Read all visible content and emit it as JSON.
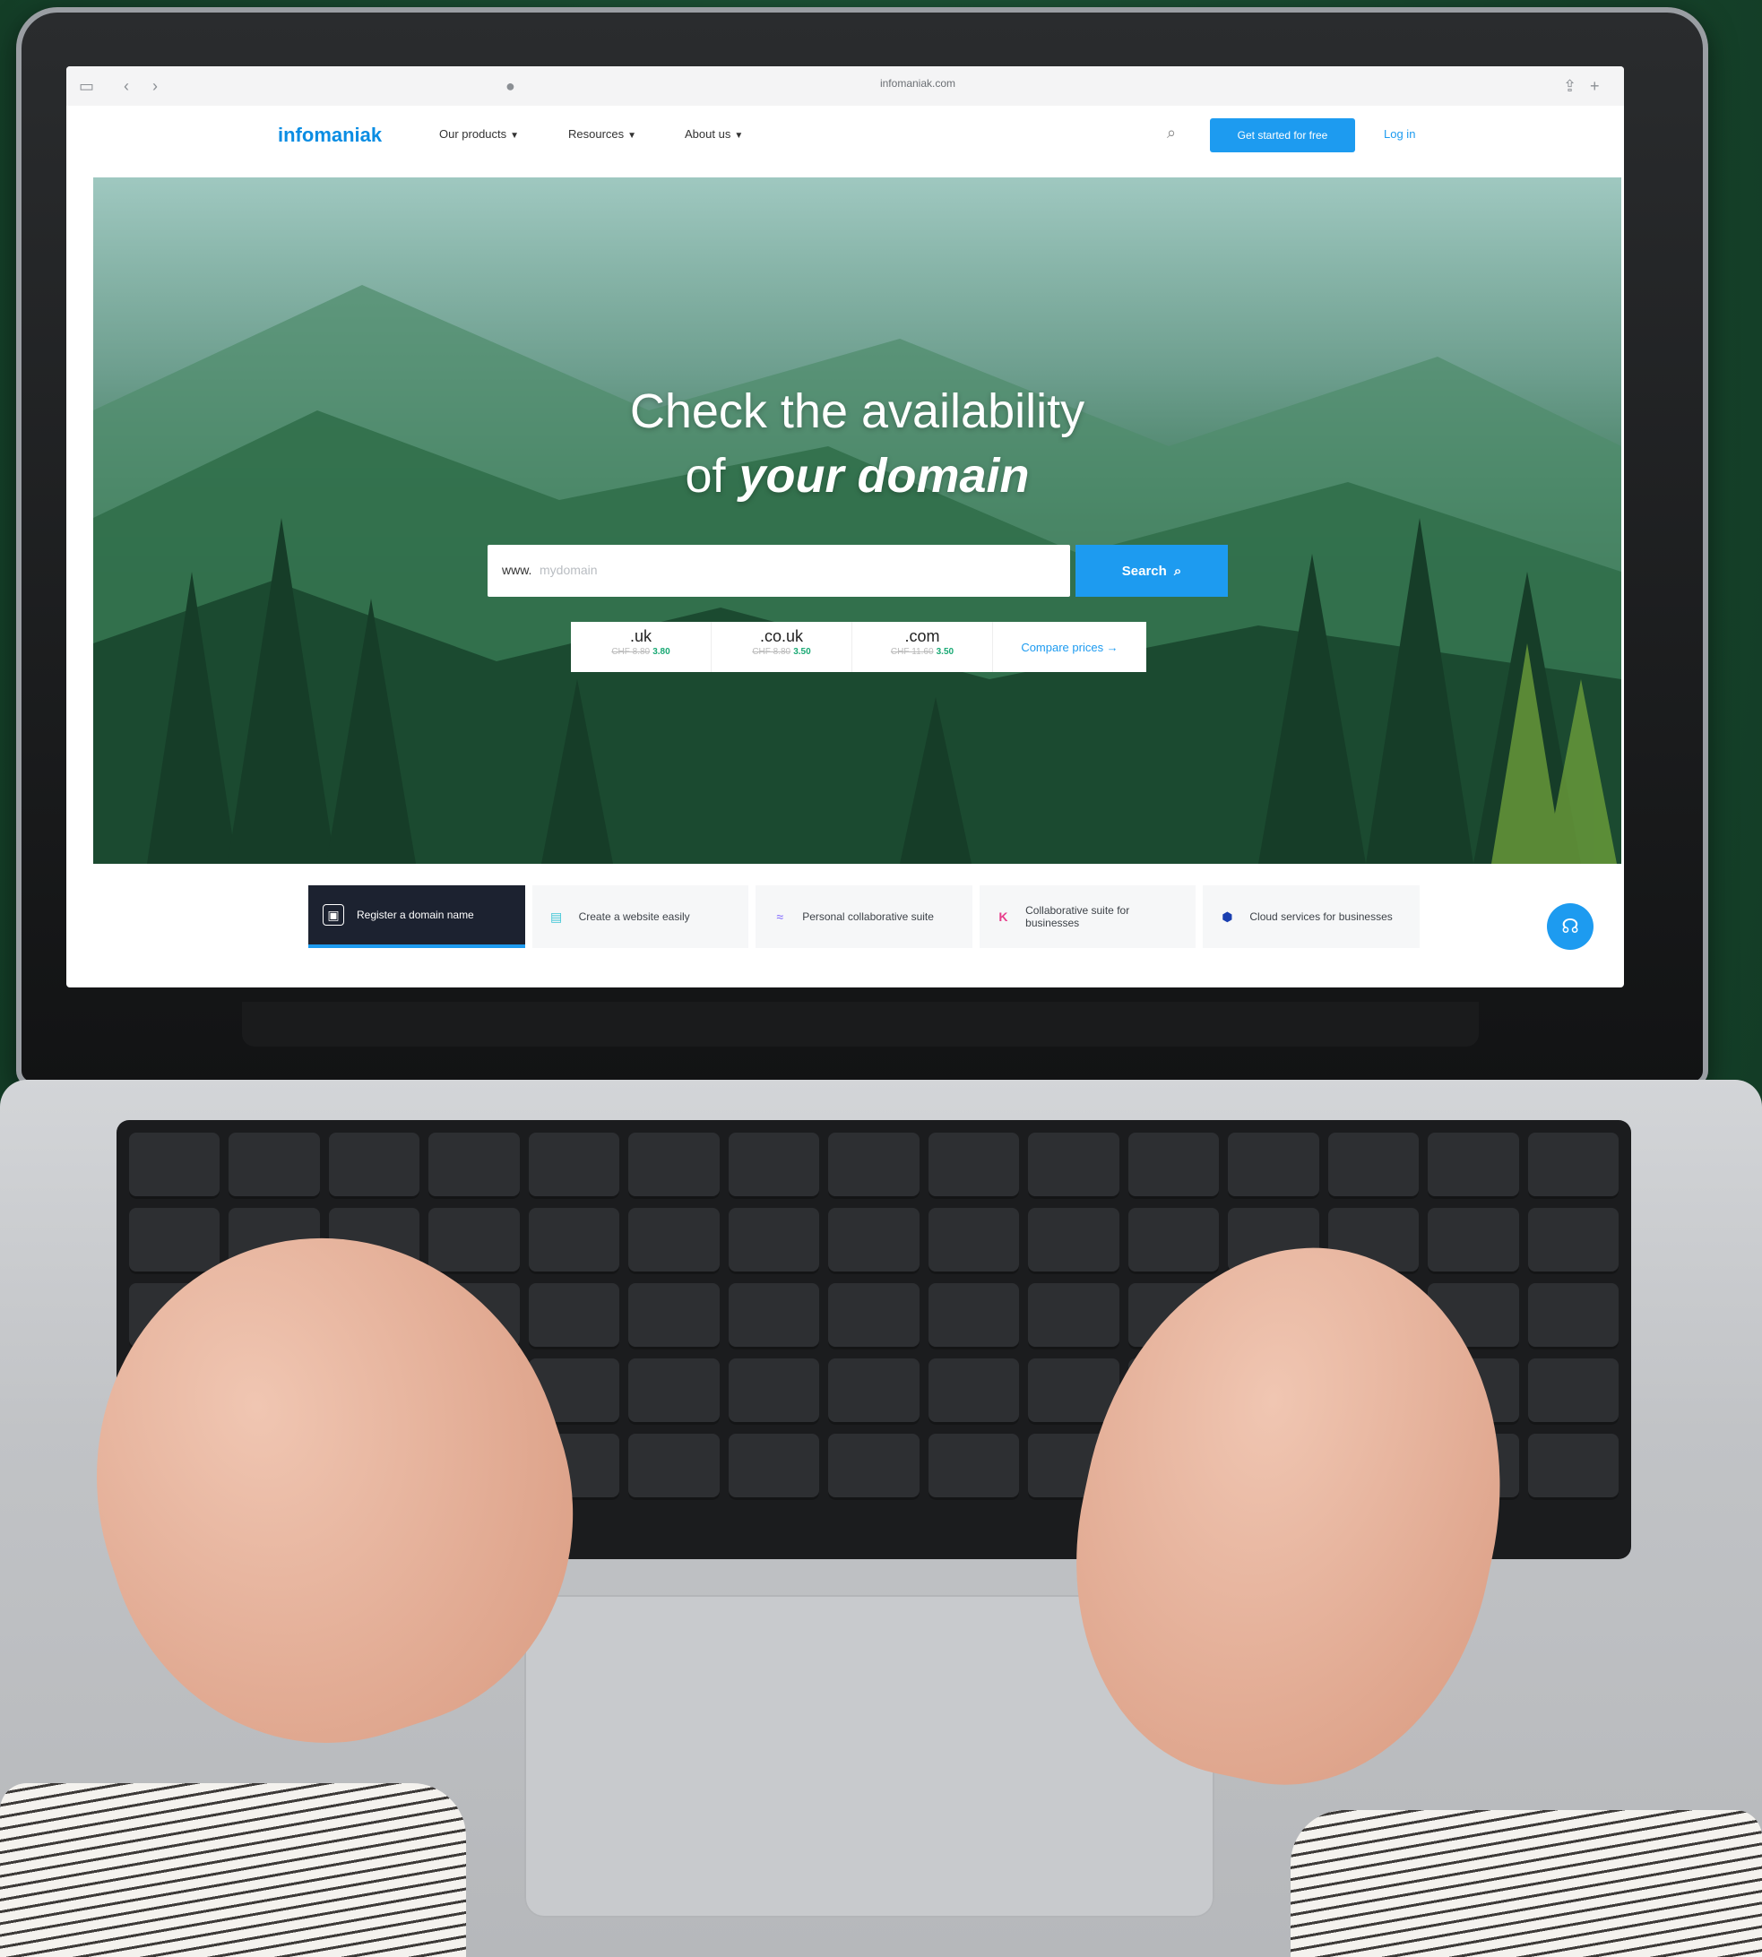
{
  "browser": {
    "url": "infomaniak.com"
  },
  "header": {
    "logo": "infomaniak",
    "nav": [
      {
        "label": "Our products"
      },
      {
        "label": "Resources"
      },
      {
        "label": "About us"
      }
    ],
    "cta_label": "Get started for free",
    "login_label": "Log in"
  },
  "hero": {
    "title_line1": "Check the availability",
    "title_line2_prefix": "of ",
    "title_line2_emphasis": "your domain",
    "search_prefix": "www.",
    "search_placeholder": "mydomain",
    "search_button": "Search",
    "compare_label": "Compare prices →",
    "prices": [
      {
        "tld": ".uk",
        "old": "CHF 8.80",
        "new": "3.80"
      },
      {
        "tld": ".co.uk",
        "old": "CHF 8.80",
        "new": "3.50"
      },
      {
        "tld": ".com",
        "old": "CHF 11.60",
        "new": "3.50"
      }
    ]
  },
  "tabs": [
    {
      "label": "Register a domain name",
      "icon": "domain-icon",
      "color": "#ffffff"
    },
    {
      "label": "Create a website easily",
      "icon": "website-icon",
      "color": "#3ec6d6"
    },
    {
      "label": "Personal collaborative suite",
      "icon": "kmail-icon",
      "color": "#7b61ff"
    },
    {
      "label": "Collaborative suite for businesses",
      "icon": "kdrive-icon",
      "color": "#e83e8c"
    },
    {
      "label": "Cloud services for businesses",
      "icon": "cloud-icon",
      "color": "#1a3fb0"
    }
  ],
  "colors": {
    "accent": "#1d9bf0",
    "dark_tab": "#1c2230"
  }
}
